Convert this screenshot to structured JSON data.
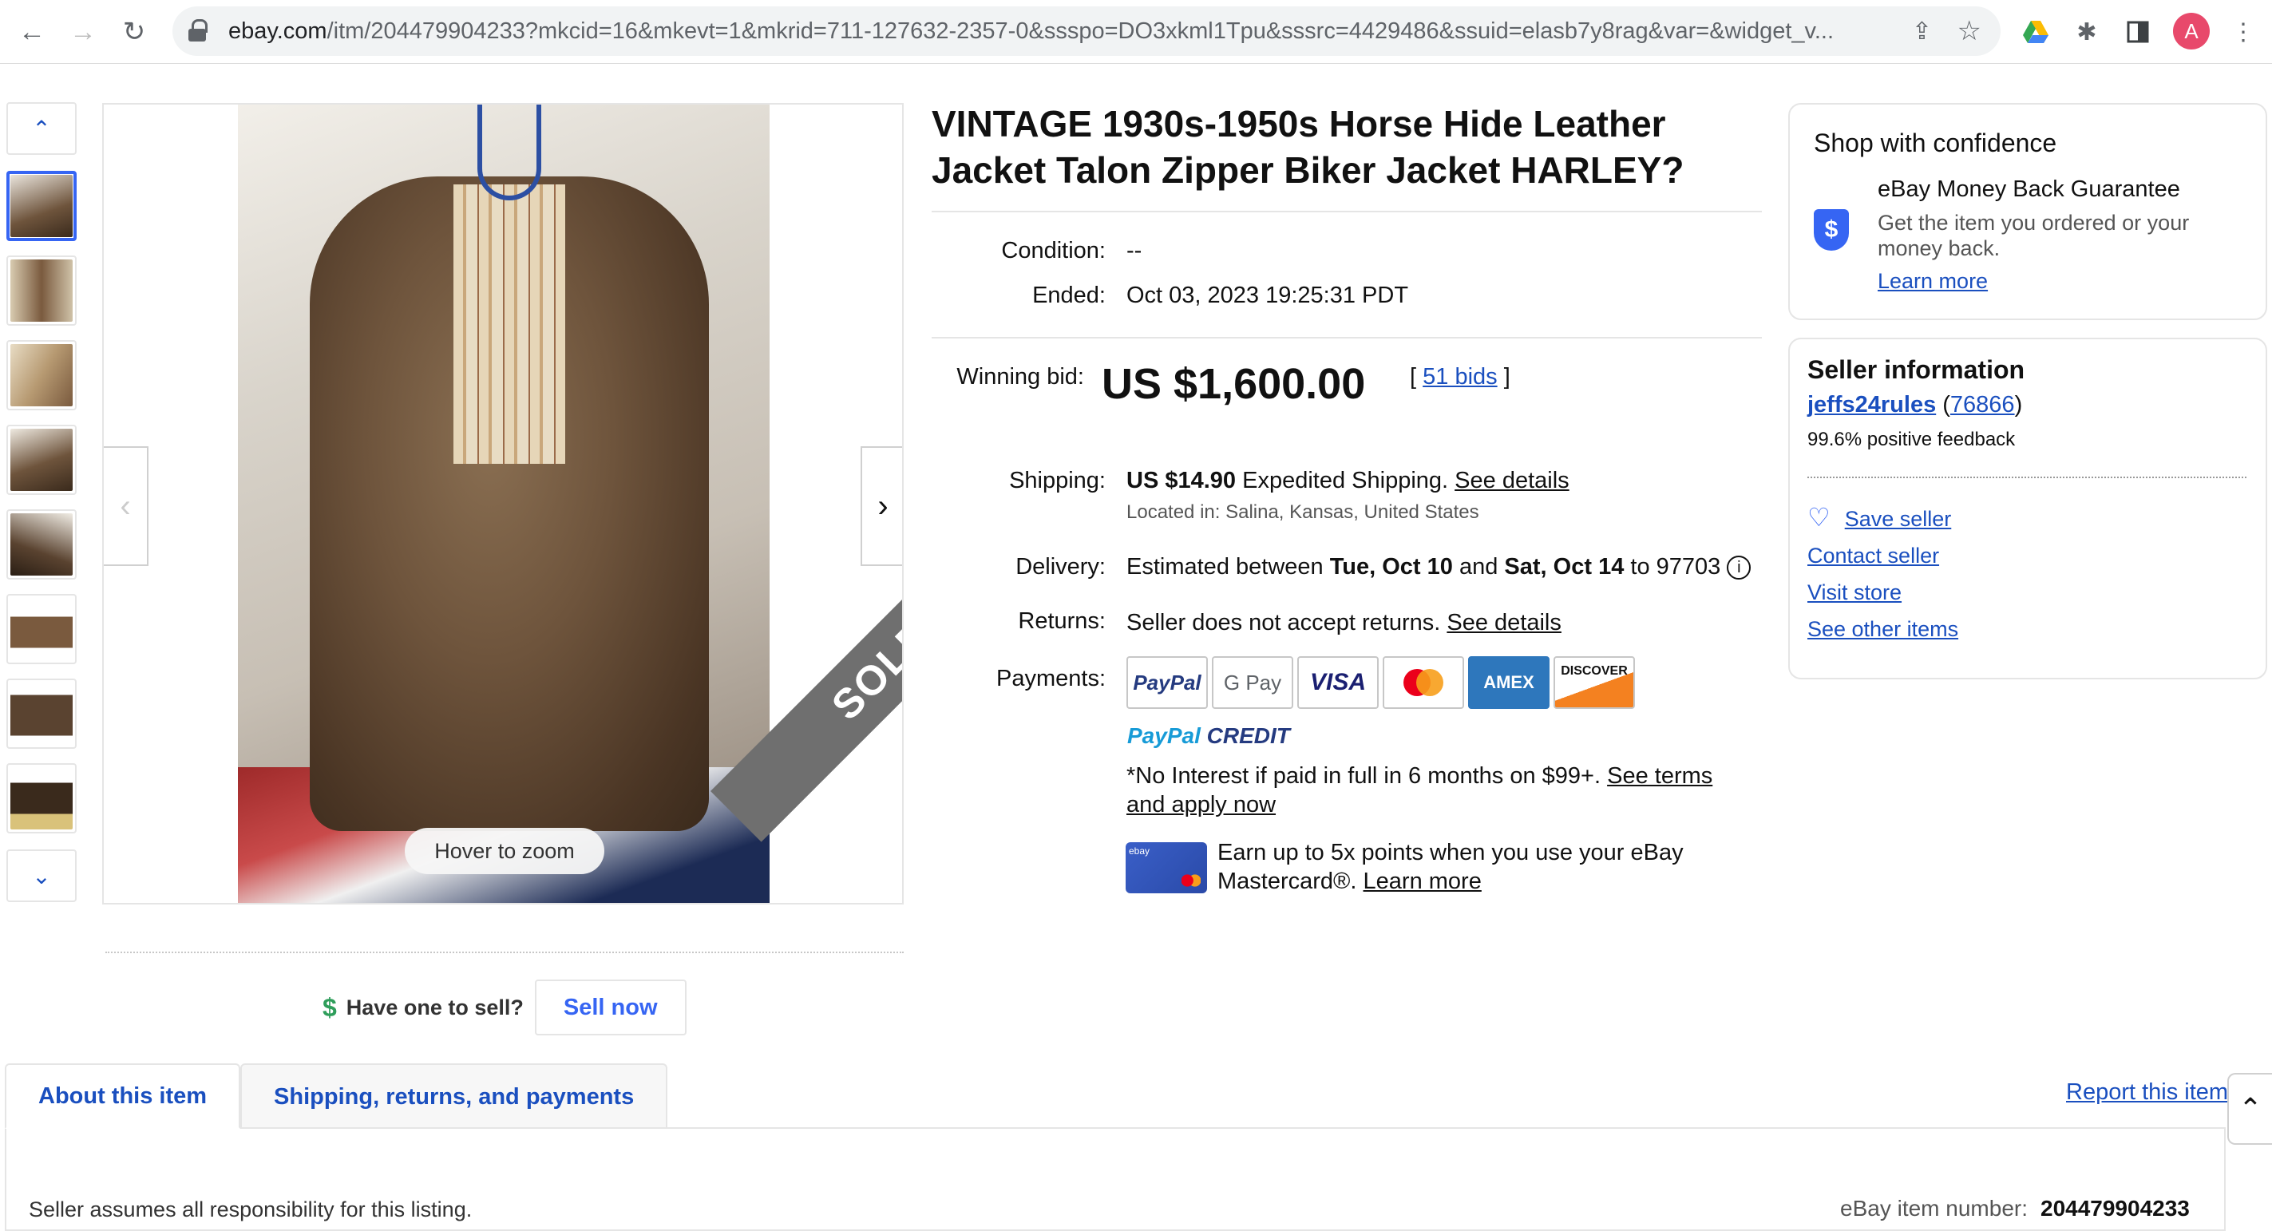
{
  "browser": {
    "url_host": "ebay.com",
    "url_path": "/itm/204479904233?mkcid=16&mkevt=1&mkrid=711-127632-2357-0&ssspo=DO3xkml1Tpu&sssrc=4429486&ssuid=elasb7y8rag&var=&widget_v...",
    "avatar_letter": "A",
    "icons": [
      "back-icon",
      "forward-icon",
      "reload-icon",
      "lock-icon",
      "share-icon",
      "star-icon",
      "drive-icon",
      "extensions-icon",
      "sidepanel-icon",
      "menu-icon"
    ]
  },
  "gallery": {
    "thumb_count": 8,
    "hover_to_zoom": "Hover to zoom",
    "sold_label": "SOLD"
  },
  "sell": {
    "question": "Have one to sell?",
    "button": "Sell now"
  },
  "item": {
    "title": "VINTAGE 1930s-1950s Horse Hide Leather Jacket Talon Zipper Biker Jacket HARLEY?",
    "condition_label": "Condition:",
    "condition_value": "--",
    "ended_label": "Ended:",
    "ended_value": "Oct 03, 2023 19:25:31 PDT",
    "winning_bid_label": "Winning bid:",
    "winning_bid_value": "US $1,600.00",
    "bids_open": "[",
    "bids_link": "51 bids",
    "bids_close": "]",
    "shipping_label": "Shipping:",
    "shipping_price": "US $14.90",
    "shipping_method": "Expedited Shipping.",
    "shipping_details": "See details",
    "located_in": "Located in: Salina, Kansas, United States",
    "delivery_label": "Delivery:",
    "delivery_prefix": "Estimated between",
    "delivery_start": "Tue, Oct 10",
    "delivery_and": "and",
    "delivery_end": "Sat, Oct 14",
    "delivery_to": "to 97703",
    "returns_label": "Returns:",
    "returns_text": "Seller does not accept returns.",
    "returns_details": "See details",
    "payments_label": "Payments:",
    "payment_methods": [
      "PayPal",
      "G Pay",
      "VISA",
      "Mastercard",
      "AMEX",
      "DISCOVER"
    ],
    "paypal_credit_1": "PayPal",
    "paypal_credit_2": "CREDIT",
    "credit_text": "*No Interest if paid in full in 6 months on $99+.",
    "credit_link": "See terms and apply now",
    "card_text": "Earn up to 5x points when you use your eBay Mastercard®.",
    "card_link": "Learn more",
    "card_logo": "ebay"
  },
  "confidence": {
    "title": "Shop with confidence",
    "guarantee_title": "eBay Money Back Guarantee",
    "guarantee_text": "Get the item you ordered or your money back.",
    "learn_more": "Learn more",
    "shield_symbol": "$"
  },
  "seller": {
    "title": "Seller information",
    "name": "jeffs24rules",
    "score": "76866",
    "feedback": "99.6% positive feedback",
    "save": "Save seller",
    "contact": "Contact seller",
    "visit": "Visit store",
    "other": "See other items"
  },
  "tabs": {
    "about": "About this item",
    "shipping": "Shipping, returns, and payments",
    "report": "Report this item"
  },
  "footer": {
    "responsibility": "Seller assumes all responsibility for this listing.",
    "item_number_label": "eBay item number:",
    "item_number": "204479904233"
  },
  "colors": {
    "link": "#1a4fbf",
    "accent": "#3665f3",
    "sold": "#6f6f6f"
  }
}
